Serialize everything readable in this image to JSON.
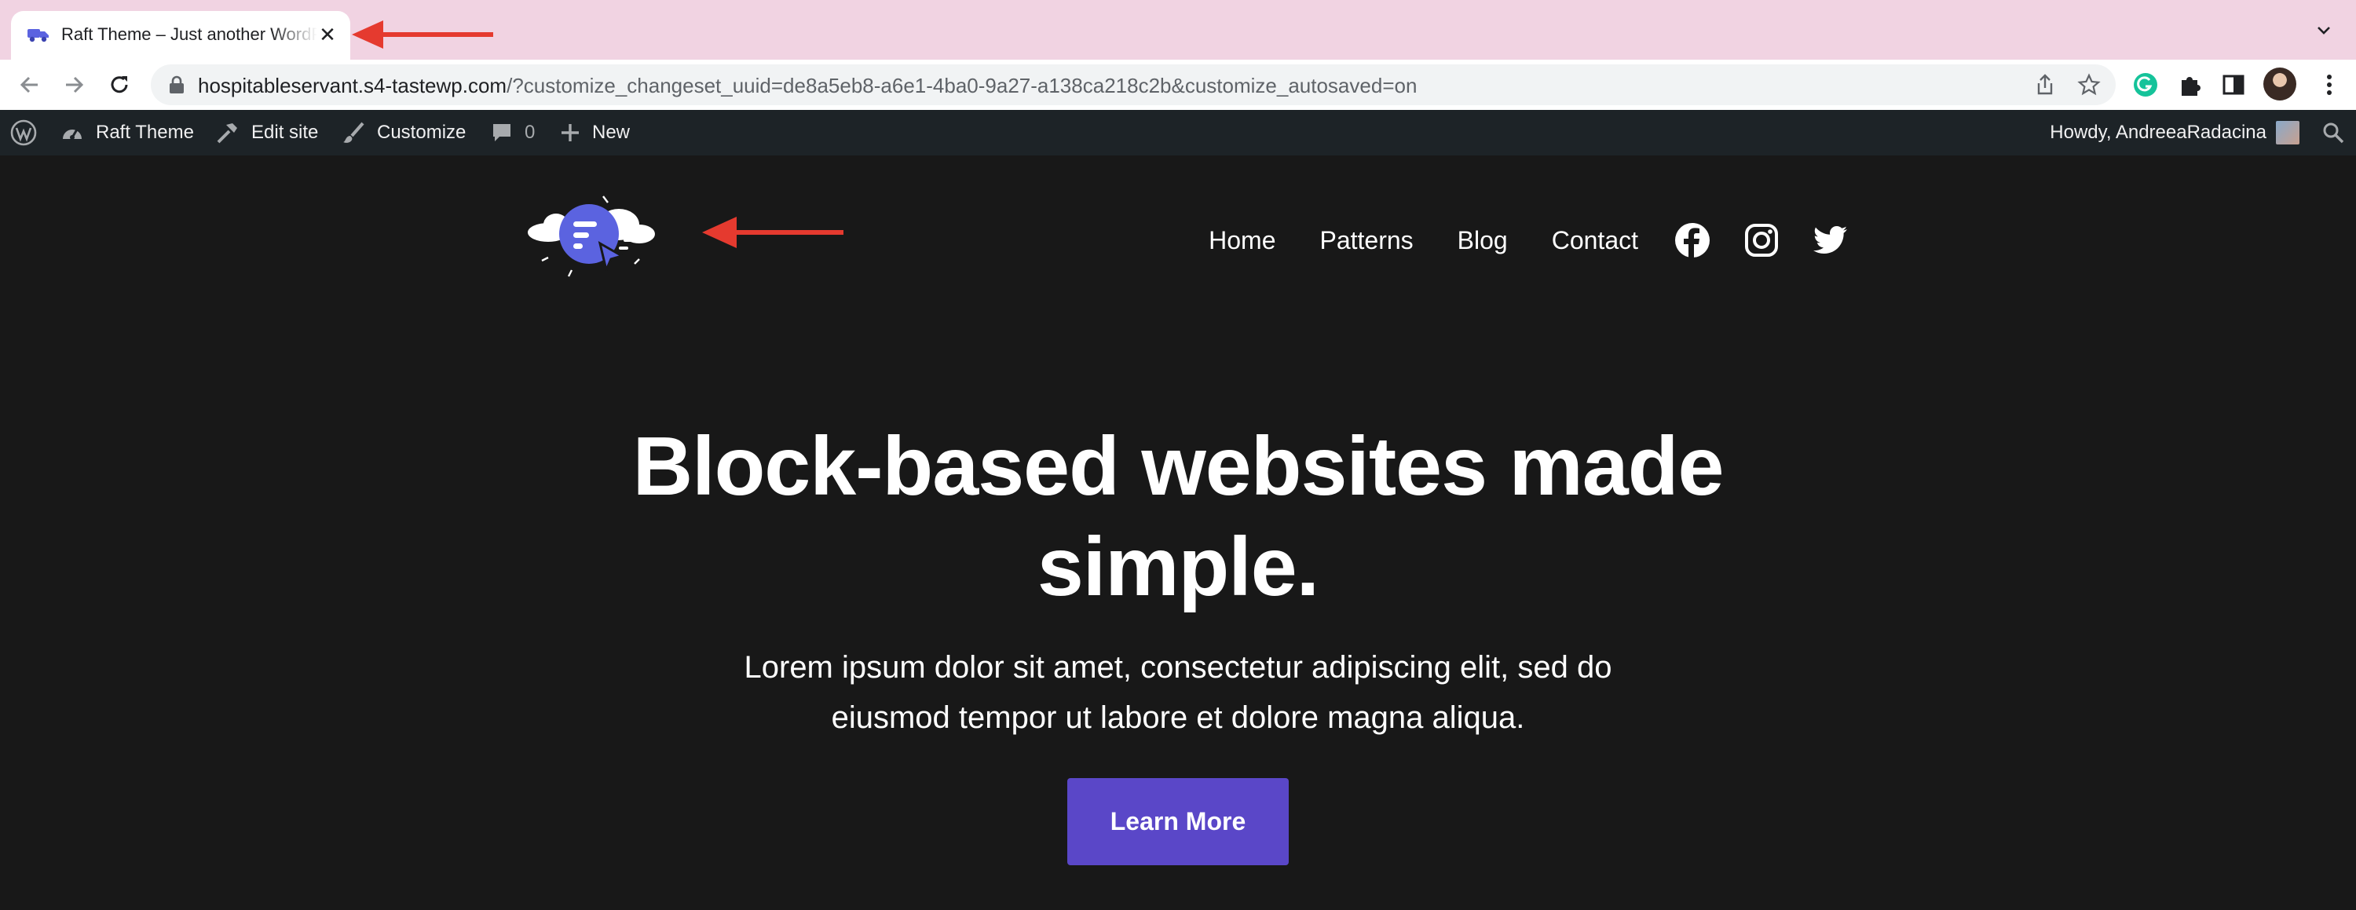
{
  "browser": {
    "tab_title": "Raft Theme – Just another WordPress site",
    "url_host": "hospitableservant.s4-tastewp.com",
    "url_rest": "/?customize_changeset_uuid=de8a5eb8-a6e1-4ba0-9a27-a138ca218c2b&customize_autosaved=on",
    "icons": [
      "truck-favicon-icon",
      "close-icon",
      "chevron-down-icon",
      "back-arrow-icon",
      "forward-arrow-icon",
      "reload-icon",
      "lock-icon",
      "share-icon",
      "star-icon",
      "grammarly-icon",
      "puzzle-extensions-icon",
      "side-panel-icon",
      "profile-avatar",
      "kebab-menu-icon"
    ]
  },
  "adminbar": {
    "site_name": "Raft Theme",
    "edit_site": "Edit site",
    "customize": "Customize",
    "comments_count": "0",
    "new": "New",
    "howdy": "Howdy, AndreeaRadacina"
  },
  "site": {
    "nav": [
      "Home",
      "Patterns",
      "Blog",
      "Contact"
    ],
    "social": [
      "facebook-icon",
      "instagram-icon",
      "twitter-icon"
    ]
  },
  "hero": {
    "title_line1": "Block-based websites made",
    "title_line2": "simple.",
    "subtitle_line1": "Lorem ipsum dolor sit amet, consectetur adipiscing elit, sed do",
    "subtitle_line2": "eiusmod tempor ut labore et dolore magna aliqua.",
    "cta_label": "Learn More"
  },
  "colors": {
    "tab_strip_bg": "#f1d3e2",
    "page_bg": "#181818",
    "adminbar_bg": "#1d2327",
    "cta_bg": "#5a47c8",
    "annotation_arrow": "#e53a2f",
    "logo_accent": "#5b63e0"
  }
}
